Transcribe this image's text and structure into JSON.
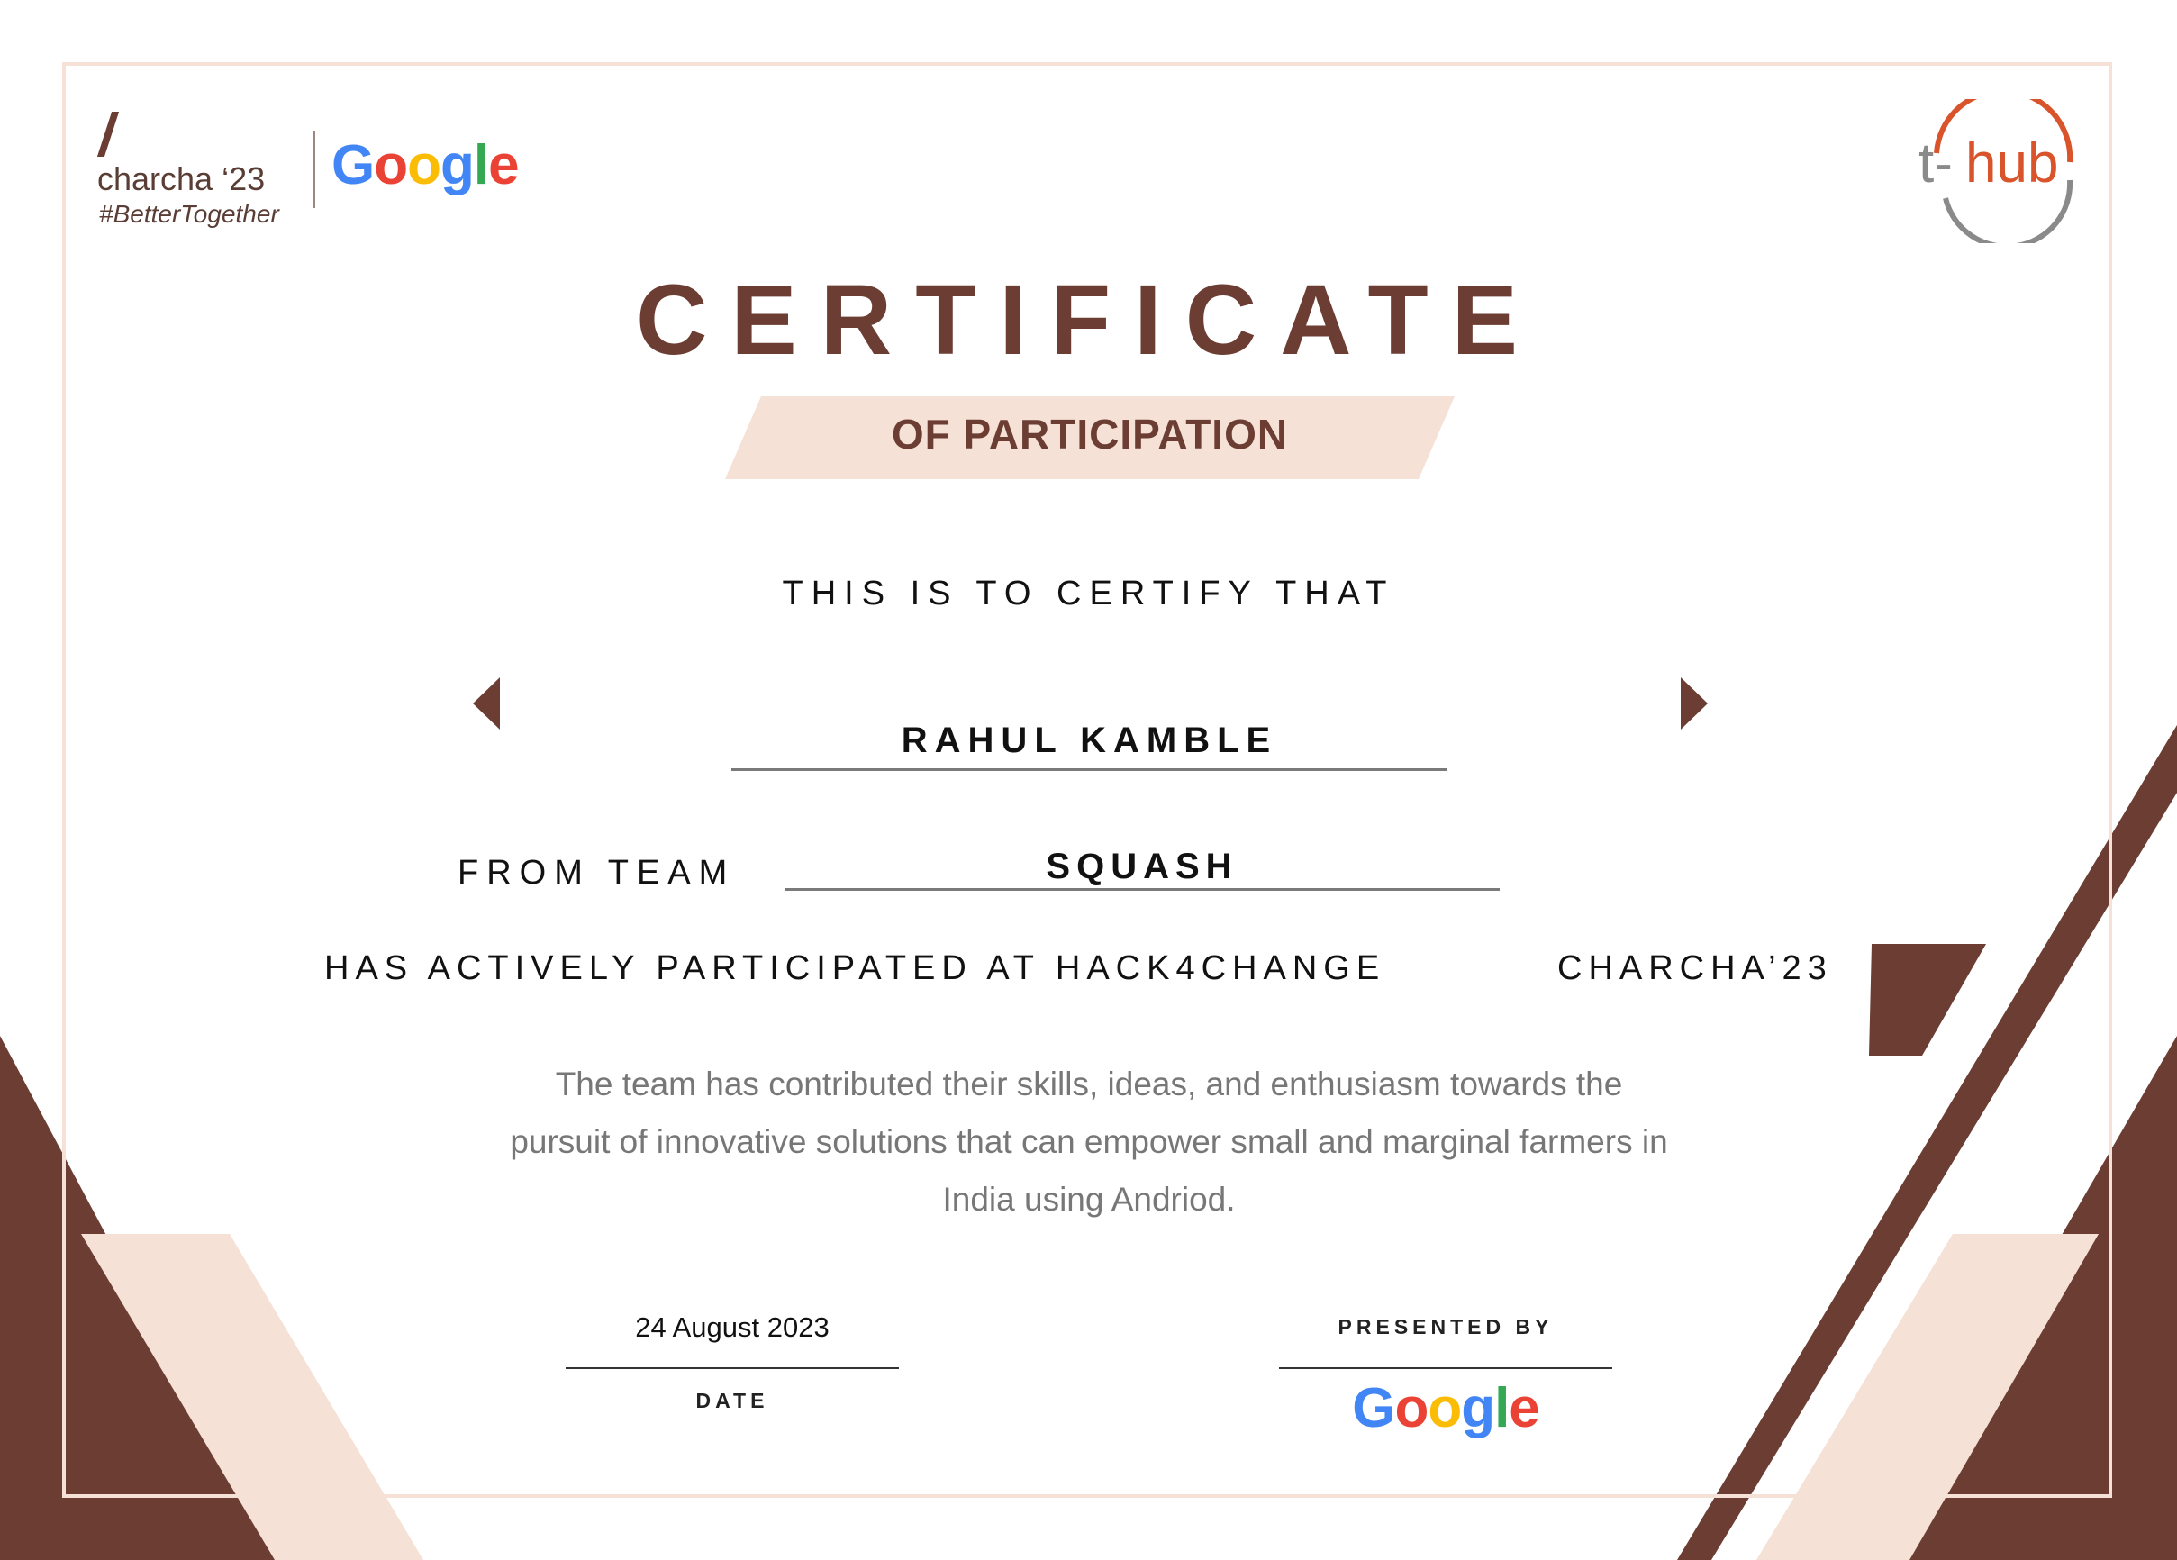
{
  "header": {
    "event_name": "charcha ‘23",
    "hashtag": "#BetterTogether",
    "google_logo": "Google",
    "thub_logo": "t-hub"
  },
  "certificate": {
    "title": "CERTIFICATE",
    "subtitle": "OF PARTICIPATION",
    "certify_text": "THIS IS TO CERTIFY THAT",
    "recipient_name": "RAHUL KAMBLE",
    "team_label": "FROM TEAM",
    "team_name": "SQUASH",
    "participation_text": "HAS ACTIVELY PARTICIPATED AT HACK4CHANGE",
    "event_text": "CHARCHA’23",
    "description": "The team has contributed their skills, ideas, and enthusiasm towards the pursuit of innovative solutions that can empower small and marginal farmers in India using Andriod."
  },
  "footer": {
    "date_value": "24 August 2023",
    "date_label": "DATE",
    "presented_label": "PRESENTED BY",
    "presented_logo": "Google"
  },
  "colors": {
    "brown": "#6b3d33",
    "peach": "#f5e1d6",
    "google_blue": "#4285f4",
    "google_red": "#ea4335",
    "google_yellow": "#fbbc05",
    "google_green": "#34a853",
    "thub_orange": "#d9532b",
    "thub_gray": "#8a8a8a"
  }
}
